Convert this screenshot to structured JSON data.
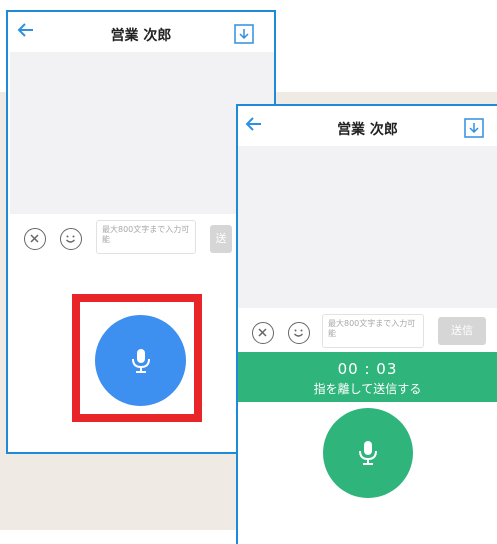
{
  "colors": {
    "frame_border": "#1f8bd8",
    "highlight": "#e8262a",
    "mic_blue": "#3d8ff0",
    "mic_green": "#2fb57c",
    "recording_bar": "#2fb57c",
    "background_band": "#efebe4"
  },
  "left_screen": {
    "header": {
      "title": "営業 次郎",
      "back_icon": "arrow-left-icon",
      "download_icon": "download-icon"
    },
    "input": {
      "placeholder": "最大800文字まで入力可能",
      "send_label": "送"
    },
    "mic_button": {
      "icon": "microphone-icon"
    }
  },
  "right_screen": {
    "header": {
      "title": "営業 次郎",
      "back_icon": "arrow-left-icon",
      "download_icon": "download-icon"
    },
    "input": {
      "placeholder": "最大800文字まで入力可能",
      "send_label": "送信"
    },
    "recording": {
      "time": "00 : 03",
      "hint": "指を離して送信する"
    },
    "mic_button": {
      "icon": "microphone-icon"
    }
  }
}
